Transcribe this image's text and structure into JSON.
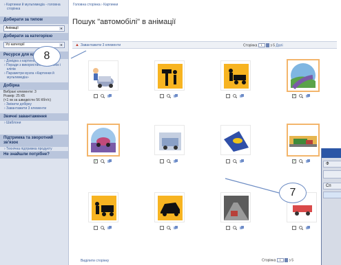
{
  "sidebar": {
    "top_link": "› Картинки й мультимедіа - головна сторінка",
    "filter_type_heading": "Добирати за типом",
    "filter_type_value": "Анімації",
    "filter_category_heading": "Добирати за категорією",
    "filter_category_value": "Усі категорії",
    "resources_heading": "Ресурси для картинок",
    "resources_links": [
      "› Довідка з картинок",
      "› Поради з використання картинок і кліпів",
      "› Параметри вузла «Картинки й мультимедіа»"
    ],
    "selection_heading": "Добірка",
    "selection_text": "Вибрані елементи: 3",
    "selection_size": "Розмір: 25 КБ",
    "selection_time": "(<1 хв за швидкістю 56 Кбіт/с)",
    "selection_links": [
      "› Змінити добірку",
      "› Завантажити 3 елементи"
    ],
    "downloaded_heading": "Звичні завантаження",
    "downloaded_link": "› Шаблони",
    "support_heading": "Підтримка та зворотний зв'язок",
    "support_link": "› Технічна підтримка продукту",
    "bottom_heading": "Не знайшли потрібне?"
  },
  "main": {
    "breadcrumb": "Головна сторінка › Картинки",
    "title": "Пошук \"автомобілі\" в анімації",
    "download_label": "Завантажити 3 елементи",
    "pager_label": "Сторінка",
    "pager_value": "1",
    "pager_of": "з 5",
    "pager_next": "Далі",
    "footer_link": "Виділити сторінку",
    "footer_pager_label": "Сторінка",
    "footer_pager_value": "1",
    "footer_pager_of": "з 5"
  },
  "thumbnails": [
    {
      "icon": "car-mechanic-clipart",
      "checked": false,
      "highlighted": false
    },
    {
      "icon": "tire-man-clipart",
      "checked": false,
      "highlighted": false
    },
    {
      "icon": "car-repair-clipart",
      "checked": false,
      "highlighted": false
    },
    {
      "icon": "winding-road-clipart",
      "checked": true,
      "highlighted": true
    },
    {
      "icon": "car-on-road-clipart",
      "checked": true,
      "highlighted": true
    },
    {
      "icon": "garage-car-clipart",
      "checked": false,
      "highlighted": false
    },
    {
      "icon": "phone-on-car-clipart",
      "checked": false,
      "highlighted": false
    },
    {
      "icon": "truck-on-road-clipart",
      "checked": true,
      "highlighted": true
    },
    {
      "icon": "worker-car-clipart",
      "checked": false,
      "highlighted": false
    },
    {
      "icon": "car-hood-clipart",
      "checked": false,
      "highlighted": false
    },
    {
      "icon": "traffic-car-clipart",
      "checked": false,
      "highlighted": false
    },
    {
      "icon": "red-car-clipart",
      "checked": false,
      "highlighted": false
    }
  ],
  "window": {
    "row1": "Ф",
    "row2": "Сп"
  },
  "callouts": {
    "first": "8",
    "second": "7"
  },
  "colors": {
    "sidebar_bg": "#dde3ee",
    "link": "#3a5e9c",
    "highlight_border": "#f3b56b",
    "window_title": "#2b56a6"
  }
}
